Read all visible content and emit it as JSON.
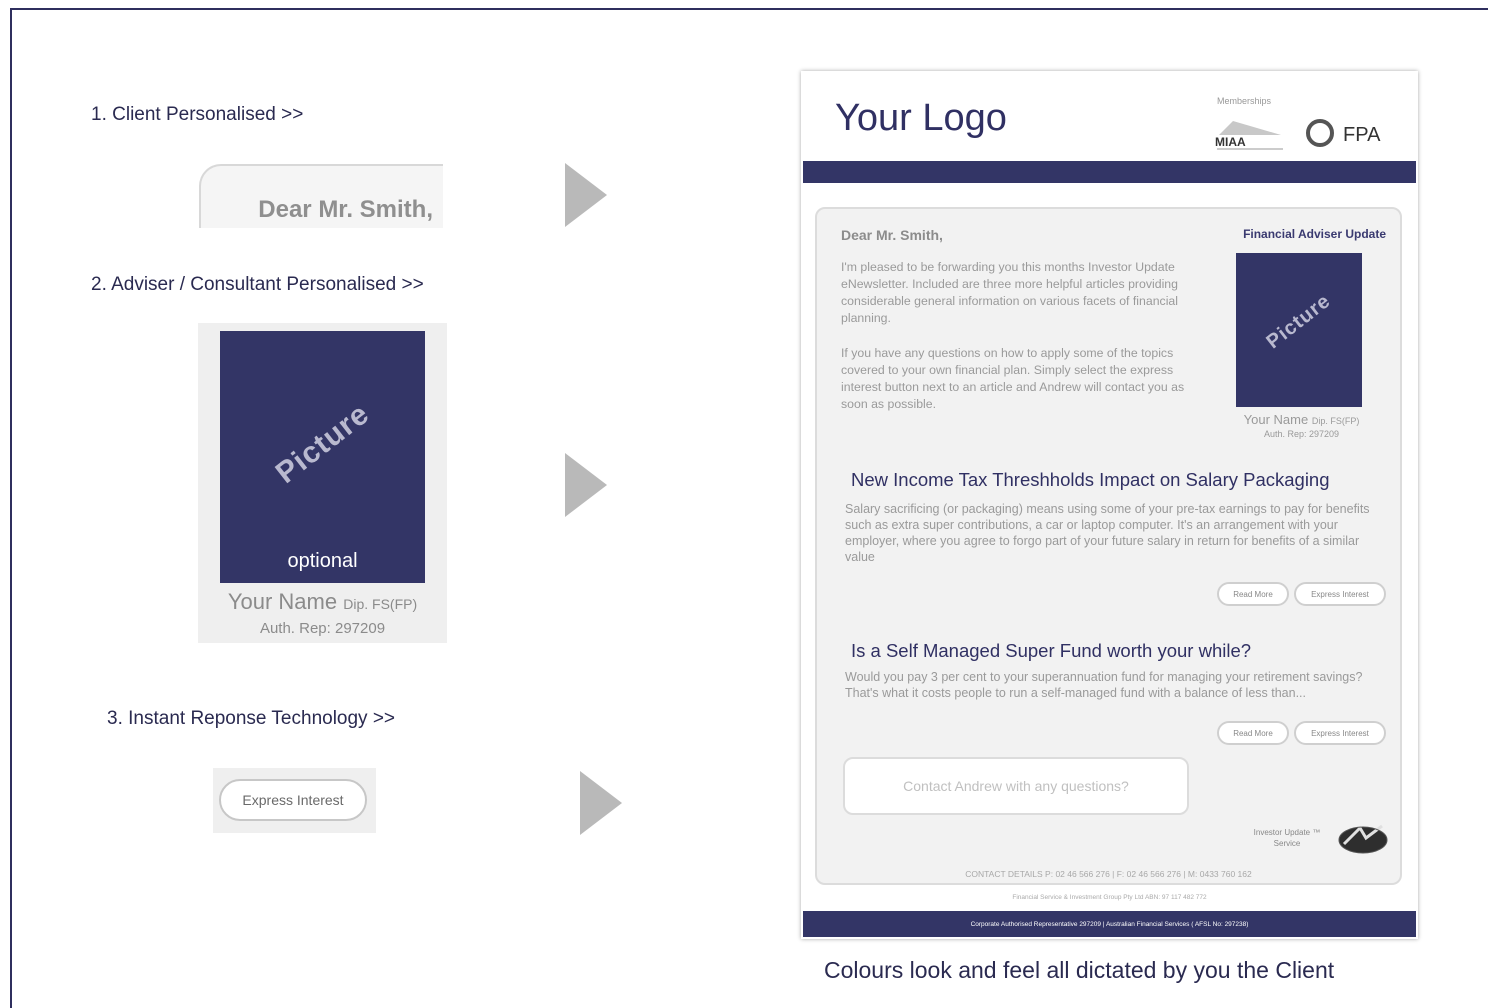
{
  "steps": {
    "step1": "1. Client Personalised >>",
    "step2": "2. Adviser / Consultant Personalised >>",
    "step3": "3. Instant Reponse Technology >>"
  },
  "client_card": {
    "greeting": "Dear Mr. Smith,"
  },
  "adviser_card": {
    "picture_word": "Picture",
    "optional": "optional",
    "name": "Your Name",
    "qualification": "Dip. FS(FP)",
    "auth_rep": "Auth. Rep: 297209"
  },
  "irt_card": {
    "button": "Express Interest"
  },
  "newsletter": {
    "logo": "Your Logo",
    "memberships": "Memberships",
    "miaa": "MIAA",
    "fpa": "FPA",
    "greeting": "Dear Mr. Smith,",
    "update_title": "Financial Adviser Update",
    "intro_p1": "I'm pleased to be forwarding you this months Investor Update eNewsletter. Included are three more helpful articles providing considerable general information on various facets of financial planning.",
    "intro_p2": "If you have any questions on how to apply some of the topics covered to your own financial plan. Simply select the express interest button next to an article and Andrew will contact you as soon as possible.",
    "picture_word": "Picture",
    "adviser_name": "Your Name",
    "adviser_qual": "Dip. FS(FP)",
    "adviser_auth": "Auth. Rep: 297209",
    "articles": [
      {
        "title": "New Income Tax Threshholds Impact on Salary Packaging",
        "text": "Salary sacrificing (or packaging) means using some of your pre-tax earnings to pay for benefits such as extra super contributions, a car or laptop computer. It's an arrangement with your employer, where you agree to forgo part of your future salary in return for benefits of a similar value",
        "read_more": "Read More",
        "express": "Express Interest"
      },
      {
        "title": "Is a Self Managed Super Fund worth your while?",
        "text": "Would you pay 3 per cent to your superannuation fund for managing your retirement savings? That's what it costs people to run a self-managed fund with a balance of less than...",
        "read_more": "Read More",
        "express": "Express Interest"
      }
    ],
    "contact_prompt": "Contact Andrew with any questions?",
    "service_line1": "Investor Update ™",
    "service_line2": "Service",
    "contact_details": "CONTACT DETAILS P: 02 46 566 276  |  F: 02 46 566 276  |  M: 0433 760 162",
    "company_line": "Financial Service & Investment Group Pty Ltd   ABN: 97 117 482 772",
    "footer": "Corporate Authorised Representative 297209  |  Australian Financial Services ( AFSL No: 297238)"
  },
  "caption": "Colours look and feel all dictated by you the Client",
  "colors": {
    "brand": "#333566",
    "arrow": "#b9b9b9",
    "panel": "#f2f2f2"
  }
}
